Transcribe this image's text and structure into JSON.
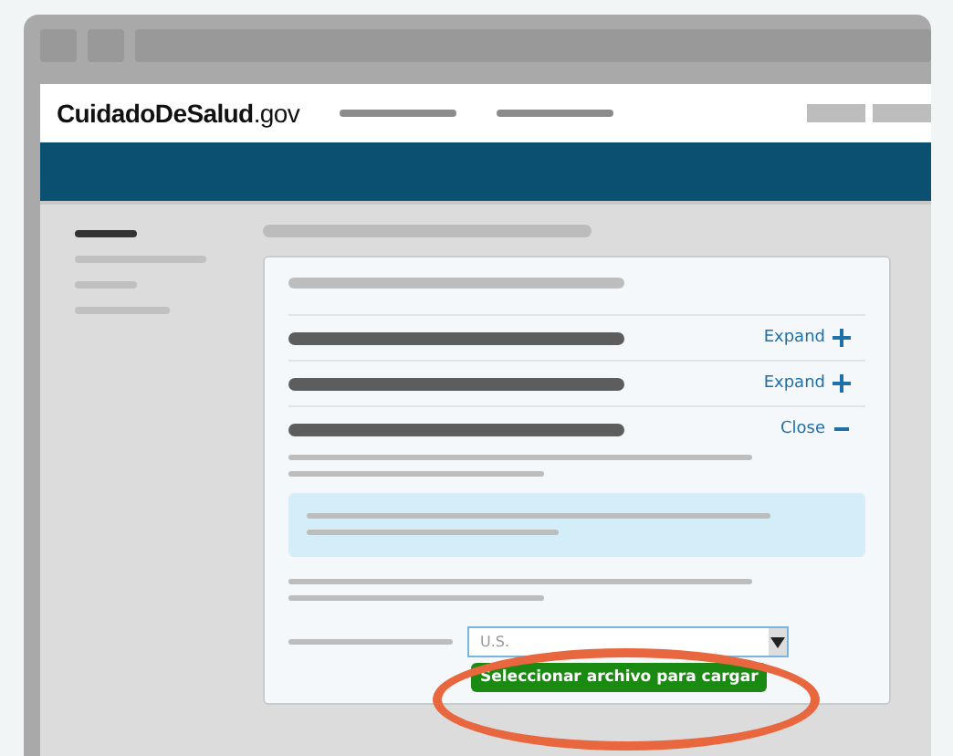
{
  "site_logo": "**CuidadoDeSalud**.gov",
  "accordion": [
    {
      "toggle": "Expand",
      "expanded": false
    },
    {
      "toggle": "Expand",
      "expanded": false
    },
    {
      "toggle": "Close",
      "expanded": true
    }
  ],
  "select": {
    "value": "U.S."
  },
  "upload_button": "Seleccionar archivo para cargar"
}
